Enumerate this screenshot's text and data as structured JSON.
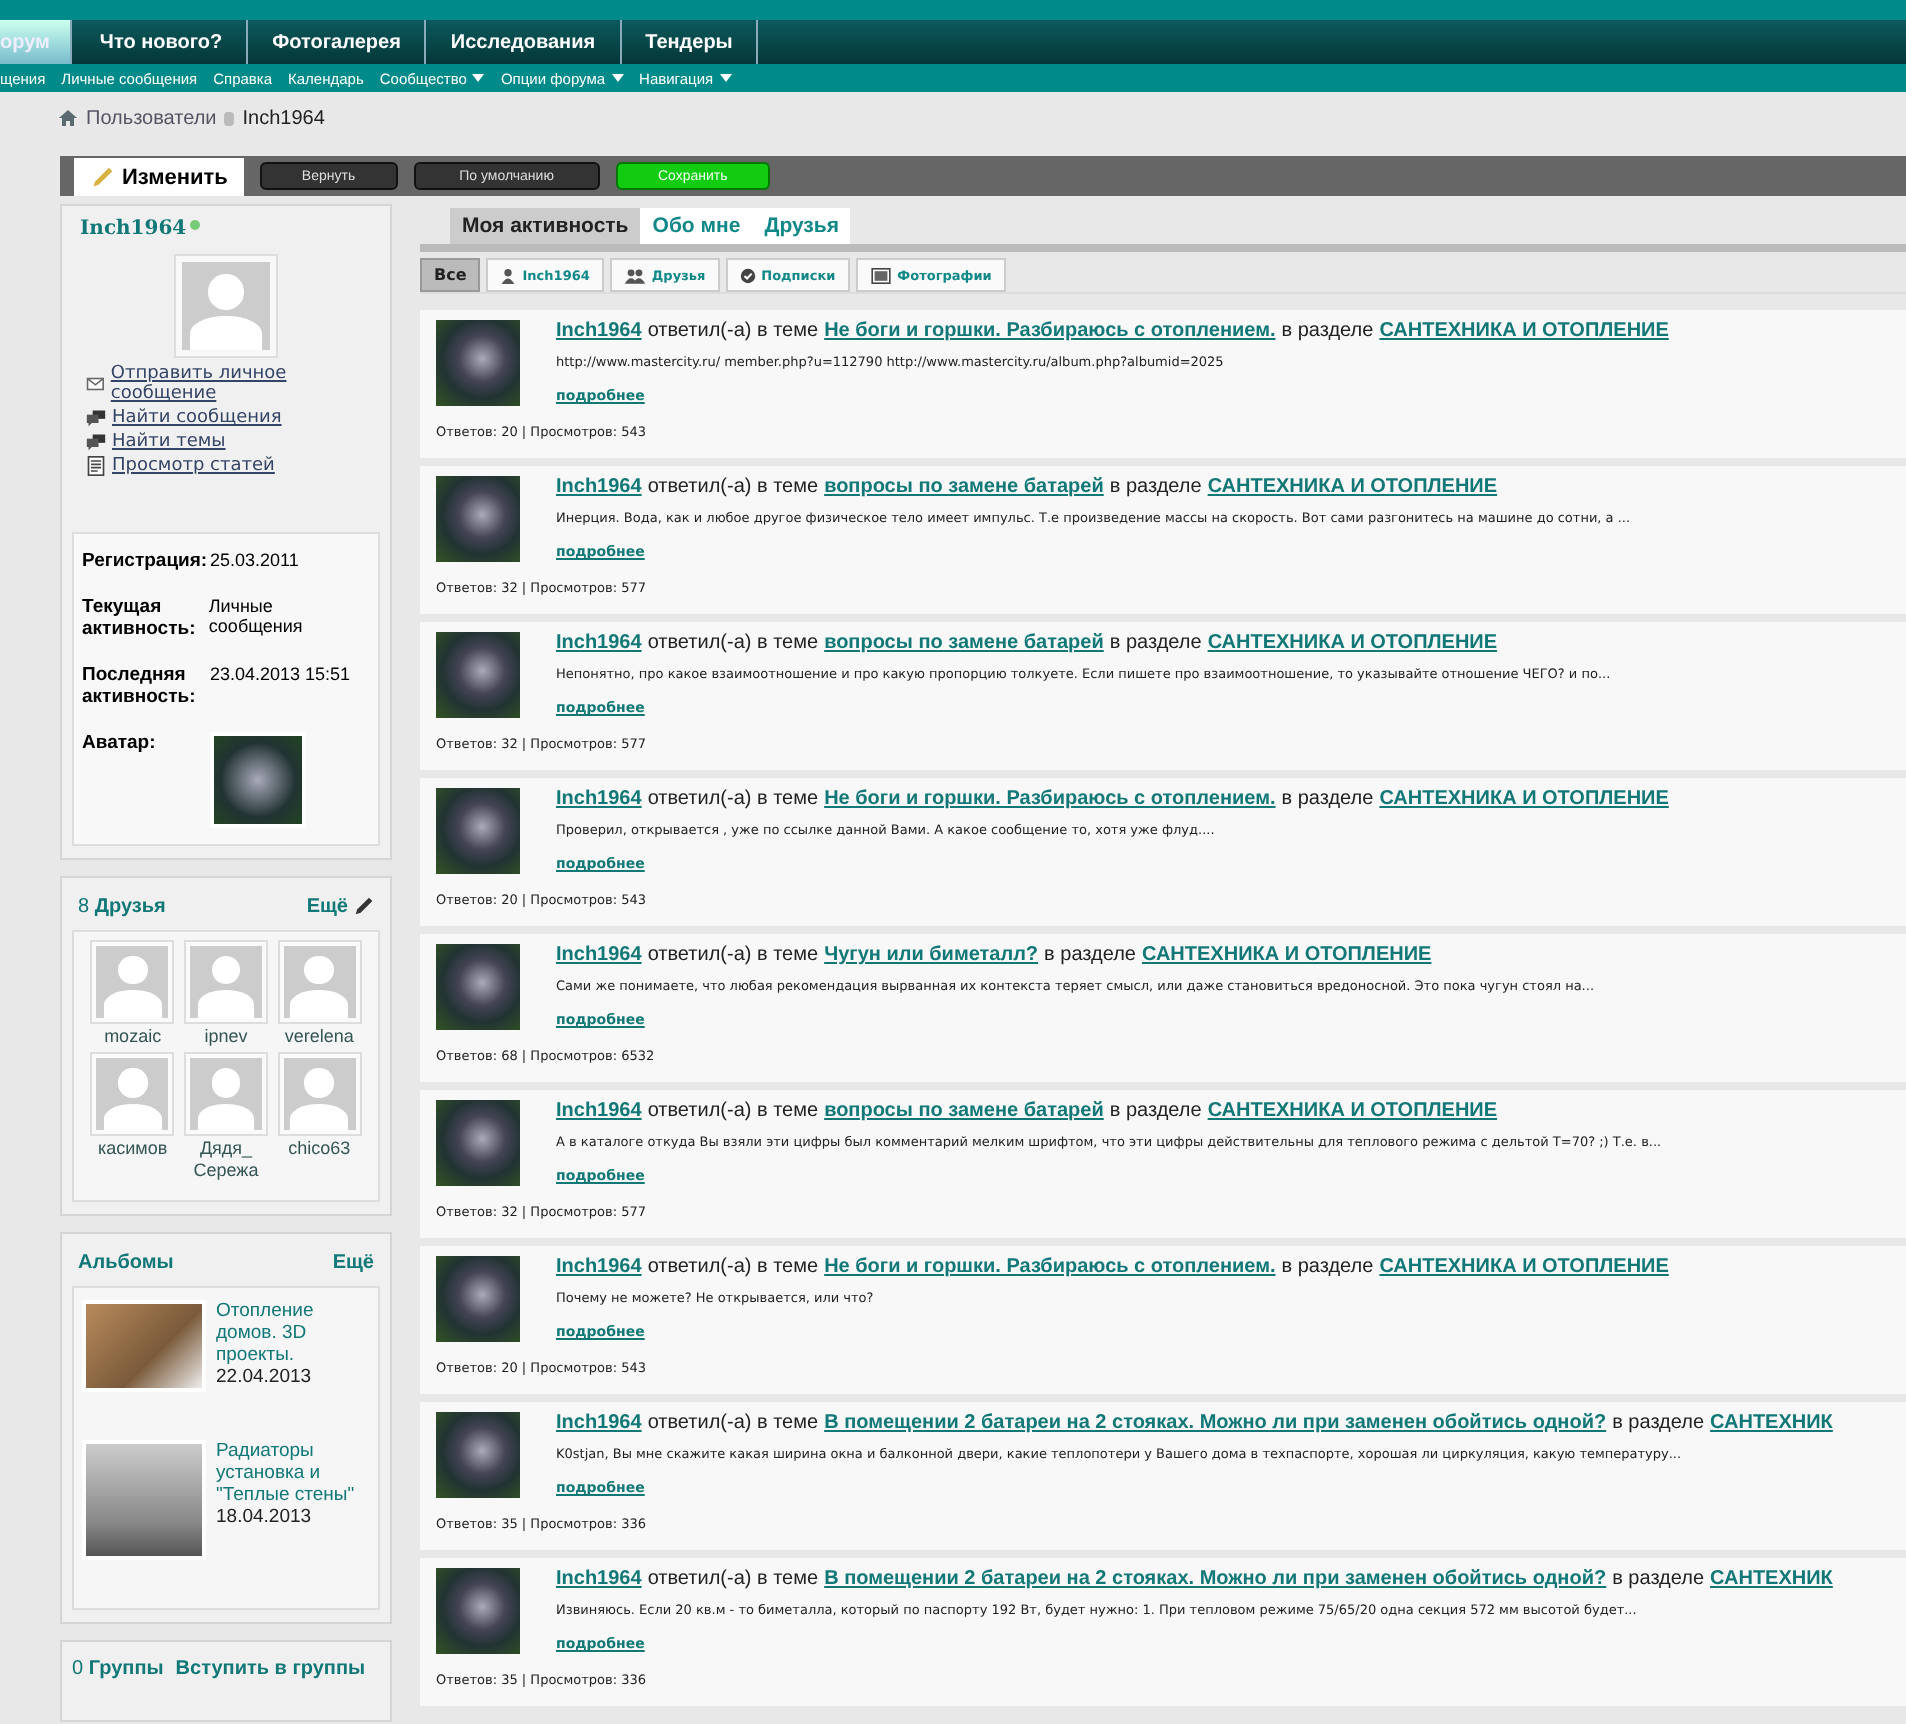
{
  "nav_tabs": [
    {
      "label": "орум",
      "selected": true
    },
    {
      "label": "Что нового?",
      "selected": false
    },
    {
      "label": "Фотогалерея",
      "selected": false
    },
    {
      "label": "Исследования",
      "selected": false
    },
    {
      "label": "Тендеры",
      "selected": false
    }
  ],
  "subnav": [
    {
      "label": "щения",
      "has_menu": false
    },
    {
      "label": "Личные сообщения",
      "has_menu": false
    },
    {
      "label": "Справка",
      "has_menu": false
    },
    {
      "label": "Календарь",
      "has_menu": false
    },
    {
      "label": "Сообщество",
      "has_menu": true
    },
    {
      "label": "Опции форума",
      "has_menu": true
    },
    {
      "label": "Навигация",
      "has_menu": true
    }
  ],
  "breadcrumb": [
    "Пользователи",
    "Inch1964"
  ],
  "edit_bar": {
    "tab": "Изменить",
    "buttons": [
      {
        "label": "Вернуть",
        "kind": "dark"
      },
      {
        "label": "По умолчанию",
        "kind": "dark"
      },
      {
        "label": "Сохранить",
        "kind": "save"
      }
    ]
  },
  "sidebar": {
    "username": "Inch1964",
    "online": true,
    "actions": [
      {
        "label": "Отправить личное сообщение",
        "kind": "envelope"
      },
      {
        "label": "Найти сообщения",
        "kind": "chat"
      },
      {
        "label": "Найти темы",
        "kind": "chat"
      },
      {
        "label": "Просмотр статей",
        "kind": "document"
      }
    ],
    "info": [
      {
        "label": "Регистрация:",
        "value": "25.03.2011"
      },
      {
        "label": "Текущая активность:",
        "value": "Личные сообщения"
      },
      {
        "label": "Последняя активность:",
        "value": "23.04.2013 15:51"
      }
    ],
    "avatar_label": "Аватар:",
    "friends": {
      "count": "8",
      "title": "Друзья",
      "more": "Ещё",
      "items": [
        "mozaic",
        "ipnev",
        "verelena",
        "касимов",
        "Дядя_ Сережа",
        "chico63"
      ]
    },
    "albums": {
      "title": "Альбомы",
      "more": "Ещё",
      "items": [
        {
          "title": "Отопление домов. 3D проекты.",
          "date": "22.04.2013"
        },
        {
          "title": "Радиаторы установка и \"Теплые стены\"",
          "date": "18.04.2013"
        }
      ]
    },
    "groups": {
      "count": "0",
      "title": "Группы",
      "join": "Вступить в группы"
    }
  },
  "main_tabs": [
    {
      "label": "Моя активность",
      "selected": true
    },
    {
      "label": "Обо мне",
      "selected": false
    },
    {
      "label": "Друзья",
      "selected": false
    }
  ],
  "filters": [
    {
      "label": "Все",
      "kind": "all",
      "selected": true
    },
    {
      "label": "Inch1964",
      "kind": "person",
      "selected": false
    },
    {
      "label": "Друзья",
      "kind": "people",
      "selected": false
    },
    {
      "label": "Подписки",
      "kind": "check",
      "selected": false
    },
    {
      "label": "Фотографии",
      "kind": "photo",
      "selected": false
    }
  ],
  "activity": [
    {
      "user": "Inch1964",
      "verb": "ответил(-а) в теме",
      "topic": "Не боги и горшки. Разбираюсь с отоплением.",
      "in_section": "в разделе",
      "section": "САНТЕХНИКА И ОТОПЛЕНИЕ",
      "excerpt": "http://www.mastercity.ru/ member.php?u=112790 http://www.mastercity.ru/album.php?albumid=2025",
      "more": "подробнее",
      "stats": "Ответов: 20 | Просмотров: 543"
    },
    {
      "user": "Inch1964",
      "verb": "ответил(-а) в теме",
      "topic": "вопросы по замене батарей",
      "in_section": "в разделе",
      "section": "САНТЕХНИКА И ОТОПЛЕНИЕ",
      "excerpt": "Инерция. Вода, как и любое другое физическое тело имеет импульс. Т.е произведение массы на скорость. Вот сами разгонитесь на машине до сотни, а ...",
      "more": "подробнее",
      "stats": "Ответов: 32 | Просмотров: 577"
    },
    {
      "user": "Inch1964",
      "verb": "ответил(-а) в теме",
      "topic": "вопросы по замене батарей",
      "in_section": "в разделе",
      "section": "САНТЕХНИКА И ОТОПЛЕНИЕ",
      "excerpt": "Непонятно, про какое взаимоотношение и про какую пропорцию толкуете. Если пишете про взаимоотношение, то указывайте отношение ЧЕГО? и по...",
      "more": "подробнее",
      "stats": "Ответов: 32 | Просмотров: 577"
    },
    {
      "user": "Inch1964",
      "verb": "ответил(-а) в теме",
      "topic": "Не боги и горшки. Разбираюсь с отоплением.",
      "in_section": "в разделе",
      "section": "САНТЕХНИКА И ОТОПЛЕНИЕ",
      "excerpt": "Проверил, открывается , уже по ссылке данной Вами. А какое сообщение то, хотя уже флуд....",
      "more": "подробнее",
      "stats": "Ответов: 20 | Просмотров: 543"
    },
    {
      "user": "Inch1964",
      "verb": "ответил(-а) в теме",
      "topic": "Чугун или биметалл?",
      "in_section": "в разделе",
      "section": "САНТЕХНИКА И ОТОПЛЕНИЕ",
      "excerpt": "Сами же понимаете, что любая рекомендация вырванная их контекста теряет смысл, или даже становиться вредоносной. Это пока чугун стоял на...",
      "more": "подробнее",
      "stats": "Ответов: 68 | Просмотров: 6532"
    },
    {
      "user": "Inch1964",
      "verb": "ответил(-а) в теме",
      "topic": "вопросы по замене батарей",
      "in_section": "в разделе",
      "section": "САНТЕХНИКА И ОТОПЛЕНИЕ",
      "excerpt": "А в каталоге откуда Вы взяли эти цифры был комментарий мелким шрифтом, что эти цифры действительны для теплового режима с дельтой Т=70? ;) Т.е. в...",
      "more": "подробнее",
      "stats": "Ответов: 32 | Просмотров: 577"
    },
    {
      "user": "Inch1964",
      "verb": "ответил(-а) в теме",
      "topic": "Не боги и горшки. Разбираюсь с отоплением.",
      "in_section": "в разделе",
      "section": "САНТЕХНИКА И ОТОПЛЕНИЕ",
      "excerpt": "Почему не можете? Не открывается, или что?",
      "more": "подробнее",
      "stats": "Ответов: 20 | Просмотров: 543"
    },
    {
      "user": "Inch1964",
      "verb": "ответил(-а) в теме",
      "topic": "В помещении 2 батареи на 2 стояках. Можно ли при заменен обойтись одной?",
      "in_section": "в разделе",
      "section": "САНТЕХНИК",
      "excerpt": "K0stjan, Вы мне скажите какая ширина окна и балконной двери, какие теплопотери у Вашего дома в техпаспорте, хорошая ли циркуляция, какую температуру...",
      "more": "подробнее",
      "stats": "Ответов: 35 | Просмотров: 336"
    },
    {
      "user": "Inch1964",
      "verb": "ответил(-а) в теме",
      "topic": "В помещении 2 батареи на 2 стояках. Можно ли при заменен обойтись одной?",
      "in_section": "в разделе",
      "section": "САНТЕХНИК",
      "excerpt": "Извиняюсь. Если 20 кв.м - то биметалла, который по паспорту 192 Вт, будет нужно: 1. При тепловом режиме 75/65/20 одна секция 572 мм высотой будет...",
      "more": "подробнее",
      "stats": "Ответов: 35 | Просмотров: 336"
    }
  ]
}
